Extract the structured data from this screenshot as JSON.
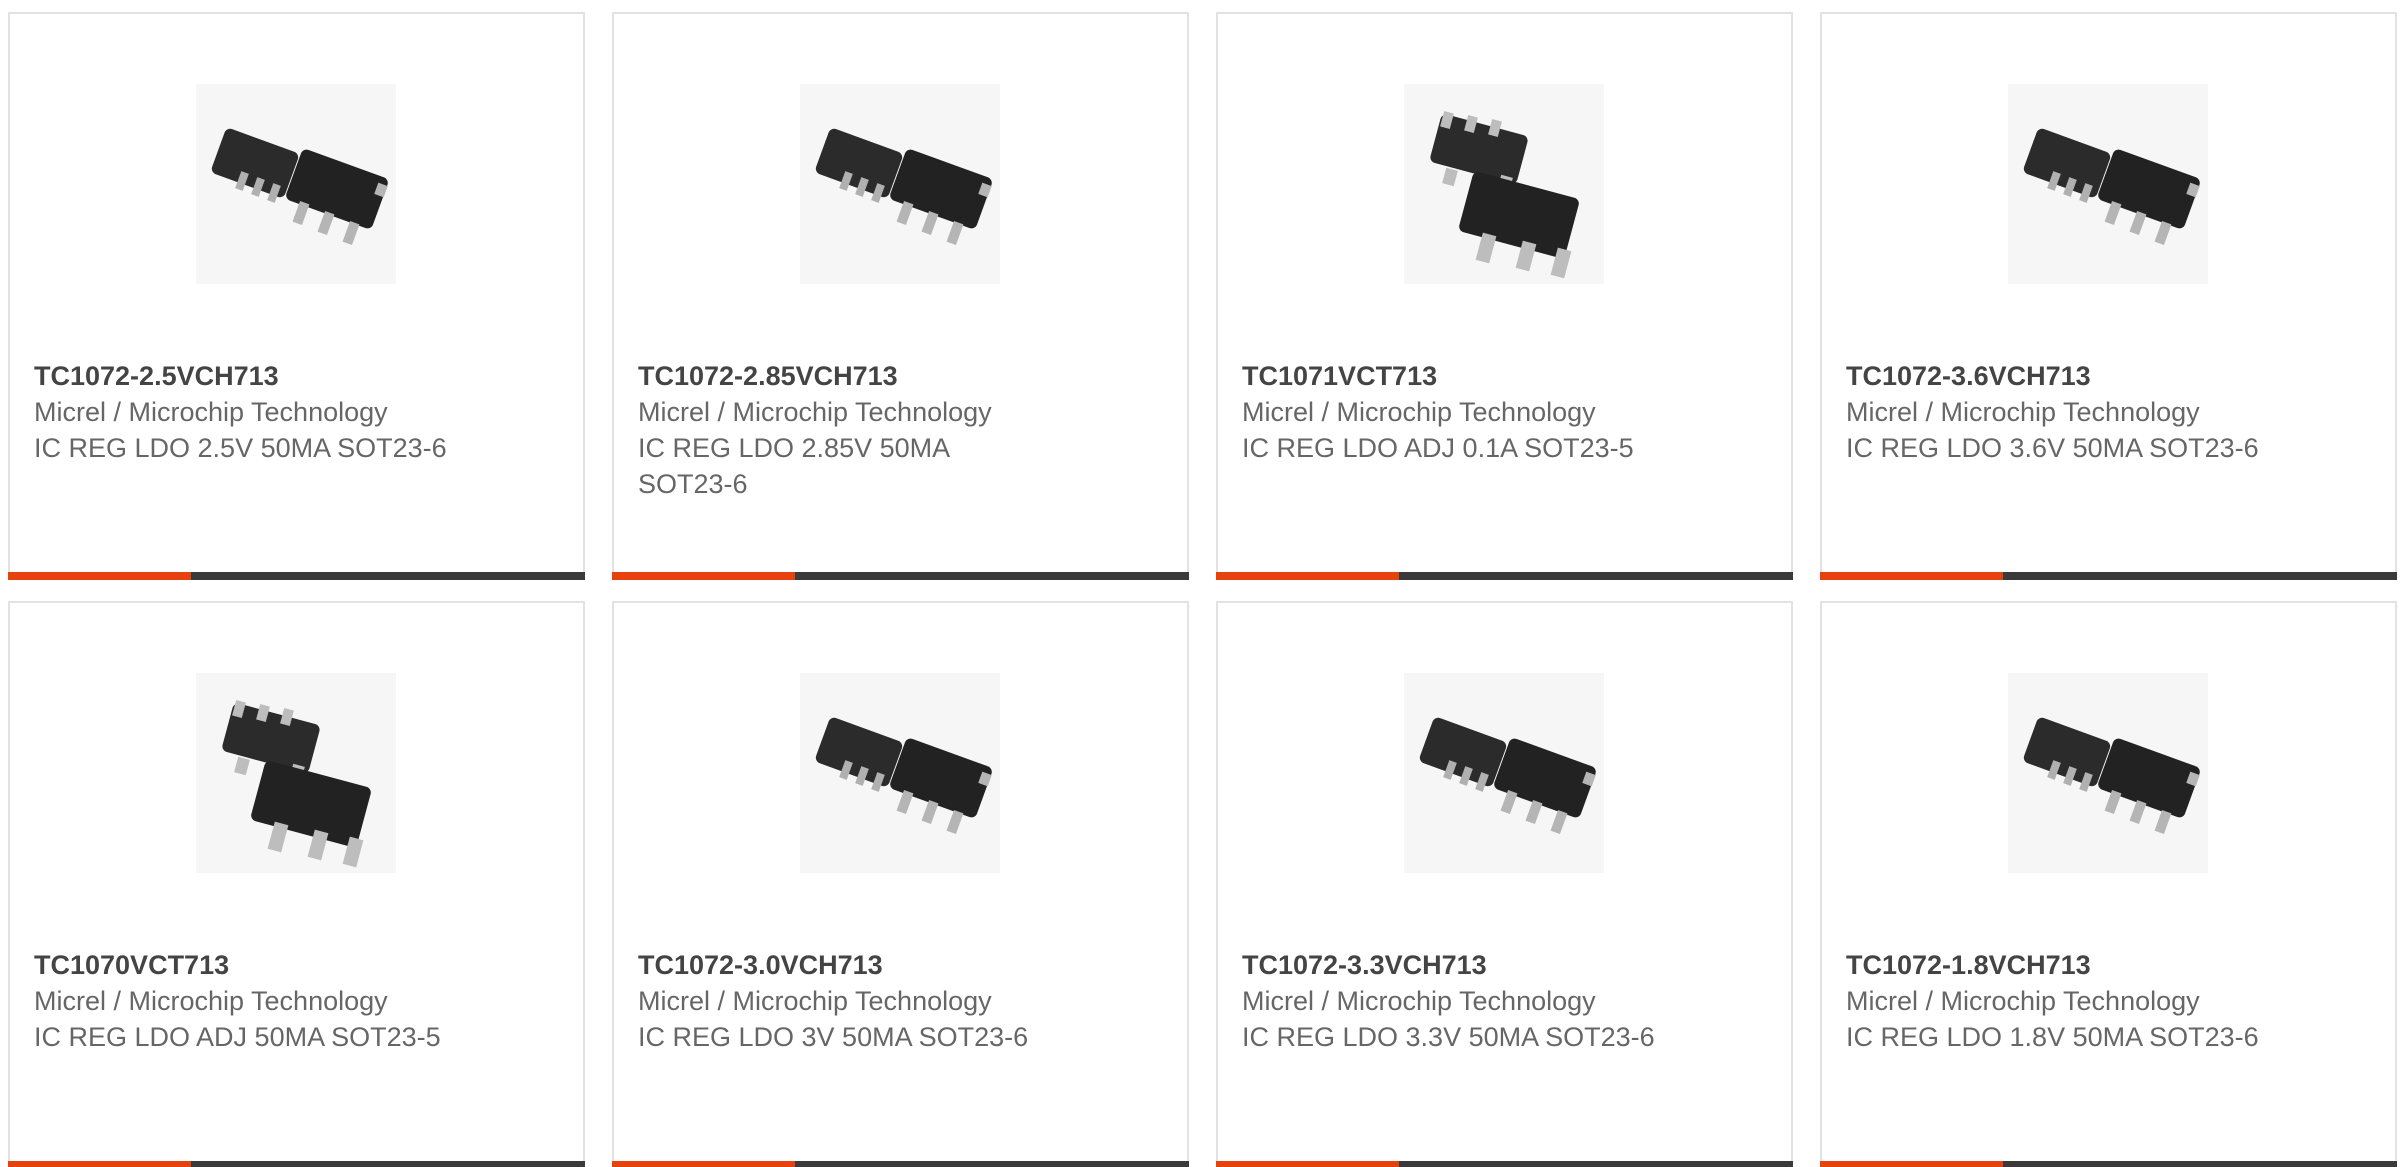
{
  "products": [
    {
      "part": "TC1072-2.5VCH713",
      "manufacturer": "Micrel / Microchip Technology",
      "description": "IC REG LDO 2.5V 50MA SOT23-6",
      "package_icon": "sot23-6-chip-icon"
    },
    {
      "part": "TC1072-2.85VCH713",
      "manufacturer": "Micrel / Microchip Technology",
      "description": "IC REG LDO 2.85V 50MA SOT23-6",
      "package_icon": "sot23-6-chip-icon"
    },
    {
      "part": "TC1071VCT713",
      "manufacturer": "Micrel / Microchip Technology",
      "description": "IC REG LDO ADJ 0.1A SOT23-5",
      "package_icon": "sot23-5-chip-icon"
    },
    {
      "part": "TC1072-3.6VCH713",
      "manufacturer": "Micrel / Microchip Technology",
      "description": "IC REG LDO 3.6V 50MA SOT23-6",
      "package_icon": "sot23-6-chip-icon"
    },
    {
      "part": "TC1070VCT713",
      "manufacturer": "Micrel / Microchip Technology",
      "description": "IC REG LDO ADJ 50MA SOT23-5",
      "package_icon": "sot23-5-chip-icon"
    },
    {
      "part": "TC1072-3.0VCH713",
      "manufacturer": "Micrel / Microchip Technology",
      "description": "IC REG LDO 3V 50MA SOT23-6",
      "package_icon": "sot23-6-chip-icon"
    },
    {
      "part": "TC1072-3.3VCH713",
      "manufacturer": "Micrel / Microchip Technology",
      "description": "IC REG LDO 3.3V 50MA SOT23-6",
      "package_icon": "sot23-6-chip-icon"
    },
    {
      "part": "TC1072-1.8VCH713",
      "manufacturer": "Micrel / Microchip Technology",
      "description": "IC REG LDO 1.8V 50MA SOT23-6",
      "package_icon": "sot23-6-chip-icon"
    }
  ],
  "colors": {
    "accent": "#e5420f",
    "bar": "#3a3a3a",
    "border": "#e2e2e2"
  }
}
